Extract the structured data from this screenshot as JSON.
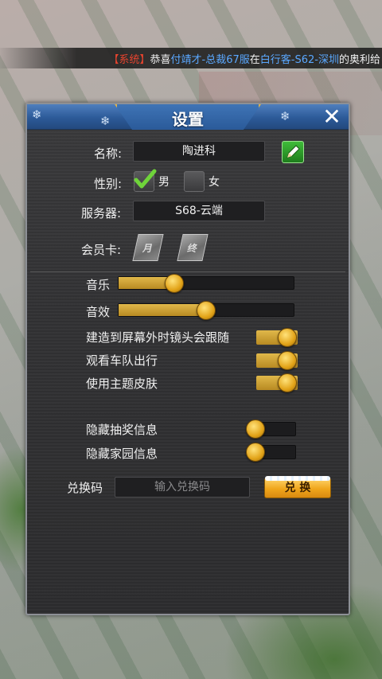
{
  "marquee": {
    "system_tag": "【系统】",
    "text1": "恭喜",
    "player_name": "付靖才-总裁67服",
    "text2": "在",
    "location": "白行客-S62-深圳",
    "text3": "的奥利给"
  },
  "dialog": {
    "title": "设置",
    "close_icon": "close-icon",
    "snowflake": "❄"
  },
  "profile": {
    "name_label": "名称:",
    "name_value": "陶进科",
    "edit_icon": "pencil-icon",
    "gender_label": "性别:",
    "gender_male": "男",
    "gender_female": "女",
    "gender_selected": "男",
    "server_label": "服务器:",
    "server_value": "S68-云端",
    "vip_label": "会员卡:",
    "vip_cards": [
      "月",
      "终"
    ]
  },
  "sliders": [
    {
      "label": "音乐",
      "value": 0.32
    },
    {
      "label": "音效",
      "value": 0.5
    }
  ],
  "toggles_on": [
    {
      "label": "建造到屏幕外时镜头会跟随",
      "on": true
    },
    {
      "label": "观看车队出行",
      "on": true
    },
    {
      "label": "使用主题皮肤",
      "on": true
    }
  ],
  "toggles_off": [
    {
      "label": "隐藏抽奖信息",
      "on": false
    },
    {
      "label": "隐藏家园信息",
      "on": false
    }
  ],
  "redeem": {
    "label": "兑换码",
    "placeholder": "输入兑换码",
    "button": "兑 换"
  },
  "colors": {
    "accent_gold": "#e0b84a",
    "header_blue": "#2c5a98",
    "system_red": "#e8442e",
    "name_blue": "#5aa8ff",
    "check_green": "#6fd43a"
  }
}
